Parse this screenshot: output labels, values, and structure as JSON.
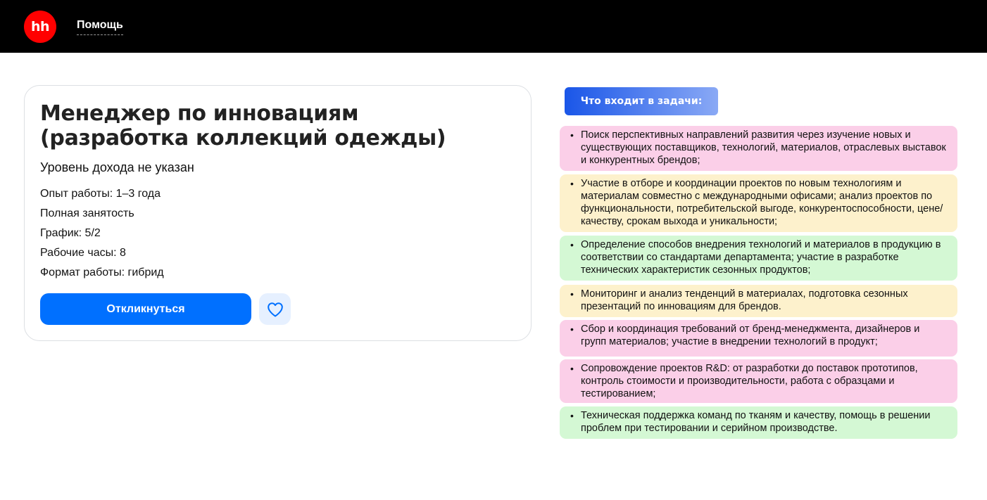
{
  "header": {
    "logo_text": "hh",
    "help_label": "Помощь"
  },
  "vacancy": {
    "title": "Менеджер по инновациям (разработка коллекций одежды)",
    "salary": "Уровень дохода не указан",
    "details": [
      "Опыт работы: 1–3 года",
      "Полная занятость",
      "График: 5/2",
      "Рабочие часы: 8",
      "Формат работы: гибрид"
    ],
    "apply_label": "Откликнуться"
  },
  "tasks": {
    "heading": "Что входит в задачи:",
    "items": [
      {
        "text": "Поиск перспективных направлений развития через изучение новых и существующих поставщиков, технологий, материалов, отраслевых выставок и конкурентных брендов;",
        "color": "#fbcfe8"
      },
      {
        "text": "Участие в отборе и координации проектов по новым технологиям и материалам совместно с международными офисами; анализ проектов по функциональности, потребительской выгоде, конкурентоспособности, цене/качеству, срокам выхода и уникальности;",
        "color": "#fdf1cc"
      },
      {
        "text": "Определение способов внедрения технологий и материалов в продукцию в соответствии со стандартами департамента; участие в разработке технических характеристик сезонных продуктов;",
        "color": "#d4f8d4"
      },
      {
        "text": "Мониторинг и анализ тенденций в материалах, подготовка сезонных презентаций по инновациям для брендов.",
        "color": "#fdf1cc"
      },
      {
        "text": "Сбор и координация требований от бренд-менеджмента, дизайнеров и групп материалов; участие в внедрении технологий в продукт;",
        "color": "#fbcfe8"
      },
      {
        "text": "Сопровождение проектов R&D: от разработки до поставок прототипов, контроль стоимости и производительности, работа с образцами и тестированием;",
        "color": "#fbcfe8"
      },
      {
        "text": "Техническая поддержка команд по тканям и качеству, помощь в решении проблем при тестировании и серийном производстве.",
        "color": "#d4f8d4"
      }
    ]
  },
  "colors": {
    "apply_button": "#0070ff",
    "logo": "#ff0000"
  },
  "icons": {
    "favorite": "heart-icon"
  }
}
